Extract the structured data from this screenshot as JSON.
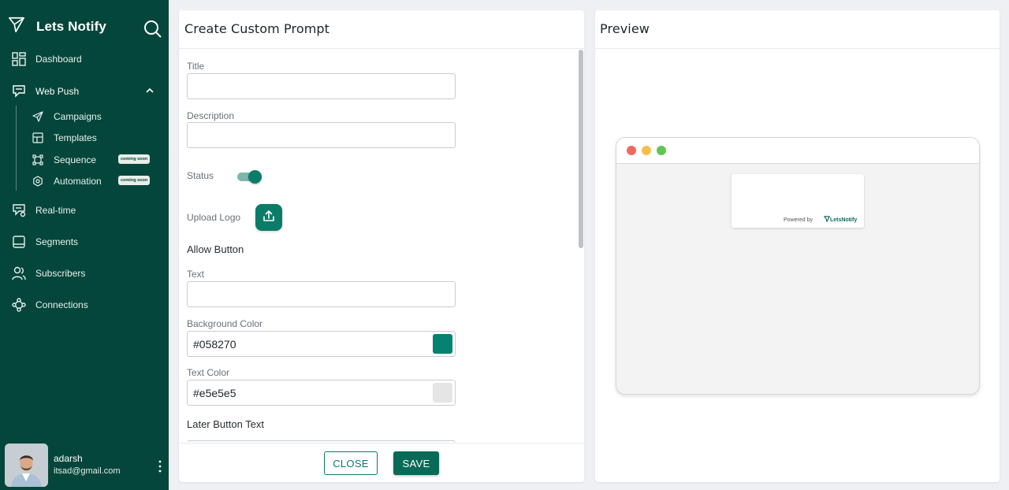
{
  "brand": {
    "name": "Lets Notify"
  },
  "nav": {
    "dashboard": "Dashboard",
    "web_push": "Web Push",
    "campaigns": "Campaigns",
    "templates": "Templates",
    "sequence": "Sequence",
    "automation": "Automation",
    "coming_soon": "coming soon",
    "realtime": "Real-time",
    "segments": "Segments",
    "subscribers": "Subscribers",
    "connections": "Connections"
  },
  "user": {
    "name": "adarsh",
    "email": "itsad@gmail.com"
  },
  "form": {
    "header": "Create Custom Prompt",
    "title_label": "Title",
    "title_value": "",
    "description_label": "Description",
    "description_value": "",
    "status_label": "Status",
    "status_on": true,
    "upload_logo_label": "Upload Logo",
    "allow_button_label": "Allow Button",
    "text_label": "Text",
    "text_value": "",
    "bg_color_label": "Background Color",
    "bg_color_value": "#058270",
    "text_color_label": "Text Color",
    "text_color_value": "#e5e5e5",
    "later_button_label": "Later Button Text",
    "close_label": "CLOSE",
    "save_label": "SAVE"
  },
  "preview": {
    "header": "Preview",
    "powered_by": "Powered by",
    "logo_text": "LetsNotify"
  },
  "colors": {
    "sidebar": "#04463b",
    "accent": "#0a7c68",
    "bg_swatch": "#058270",
    "text_swatch": "#e5e5e5",
    "dot_red": "#ed6a5e",
    "dot_yellow": "#f5bf4f",
    "dot_green": "#61c554"
  }
}
